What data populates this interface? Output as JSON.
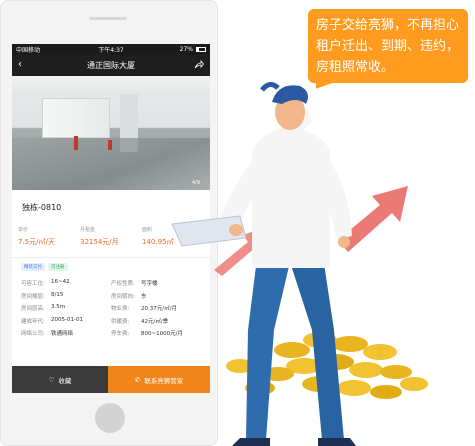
{
  "status_bar": {
    "carrier": "中国移动",
    "time": "下午4:37",
    "battery": "27%"
  },
  "nav": {
    "title": "通正国际大厦"
  },
  "photo": {
    "counter": "4/9"
  },
  "listing": {
    "title": "独栋-0810",
    "stats": [
      {
        "label": "单价",
        "value": "7.5元/㎡/天"
      },
      {
        "label": "月租金",
        "value": "32154元/月"
      },
      {
        "label": "面积",
        "value": "140.95㎡"
      }
    ],
    "tags": [
      "精装交付",
      "可注册"
    ],
    "info_rows": [
      [
        {
          "k": "可容工位:",
          "v": "16~42"
        },
        {
          "k": "产权性质:",
          "v": "写字楼"
        }
      ],
      [
        {
          "k": "房间楼层:",
          "v": "8/15"
        },
        {
          "k": "房间朝向:",
          "v": "东"
        }
      ],
      [
        {
          "k": "房间层高:",
          "v": "3.5m"
        },
        {
          "k": "物业费:",
          "v": "20.37元/㎡/月"
        }
      ],
      [
        {
          "k": "建成年代:",
          "v": "2005-01-01"
        },
        {
          "k": "供暖费:",
          "v": "42元/㎡/季"
        }
      ],
      [
        {
          "k": "网络公司:",
          "v": "铁通网络"
        },
        {
          "k": "停车费:",
          "v": "800~1000元/月"
        }
      ]
    ]
  },
  "bottom": {
    "favorite": "收藏",
    "contact": "联系亮狮管家"
  },
  "bubble": {
    "text": "房子交给亮狮，不再担心租户迁出、到期、违约，房租照常收。"
  },
  "colors": {
    "accent_orange": "#f08519",
    "price": "#ee6a2a",
    "bubble": "#ff9c1f",
    "arrow": "#ec7a74"
  },
  "icons": [
    "back-arrow-icon",
    "share-icon",
    "heart-icon",
    "phone-icon",
    "wifi-icon"
  ]
}
